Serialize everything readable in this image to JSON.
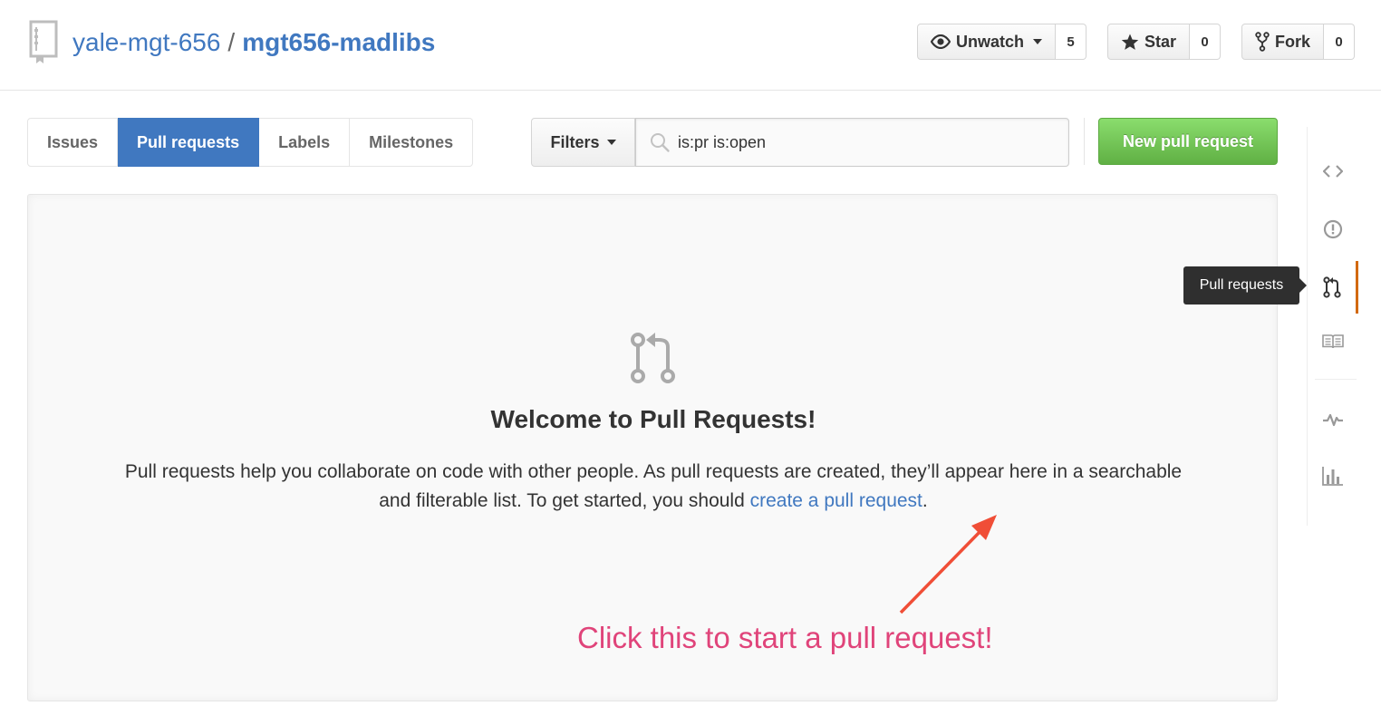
{
  "repo": {
    "owner": "yale-mgt-656",
    "separator": "/",
    "name": "mgt656-madlibs",
    "icon": "repo-icon"
  },
  "actions": {
    "watch": {
      "label": "Unwatch",
      "count": "5",
      "icon": "eye-icon"
    },
    "star": {
      "label": "Star",
      "count": "0",
      "icon": "star-icon"
    },
    "fork": {
      "label": "Fork",
      "count": "0",
      "icon": "fork-icon"
    }
  },
  "subnav": {
    "items": [
      {
        "label": "Issues",
        "selected": false
      },
      {
        "label": "Pull requests",
        "selected": true
      },
      {
        "label": "Labels",
        "selected": false
      },
      {
        "label": "Milestones",
        "selected": false
      }
    ],
    "filters_label": "Filters",
    "search_value": "is:pr is:open",
    "new_button_label": "New pull request"
  },
  "blankslate": {
    "icon": "git-pull-request-icon",
    "title": "Welcome to Pull Requests!",
    "text_before": "Pull requests help you collaborate on code with other people. As pull requests are created, they’ll appear here in a searchable and filterable list. To get started, you should ",
    "link_text": "create a pull request",
    "text_after": "."
  },
  "annotation": {
    "text": "Click this to start a pull request!",
    "color": "#e0447a",
    "arrow_color": "#f04e37"
  },
  "rightnav": {
    "tooltip": "Pull requests",
    "items": [
      "code-icon",
      "issue-icon",
      "git-pull-request-icon",
      "wiki-book-icon",
      "pulse-icon",
      "graph-icon"
    ],
    "selected_accent": "#d26911"
  },
  "colors": {
    "link": "#4078c0",
    "selected_tab": "#4078c0",
    "new_button": "#60b044"
  }
}
